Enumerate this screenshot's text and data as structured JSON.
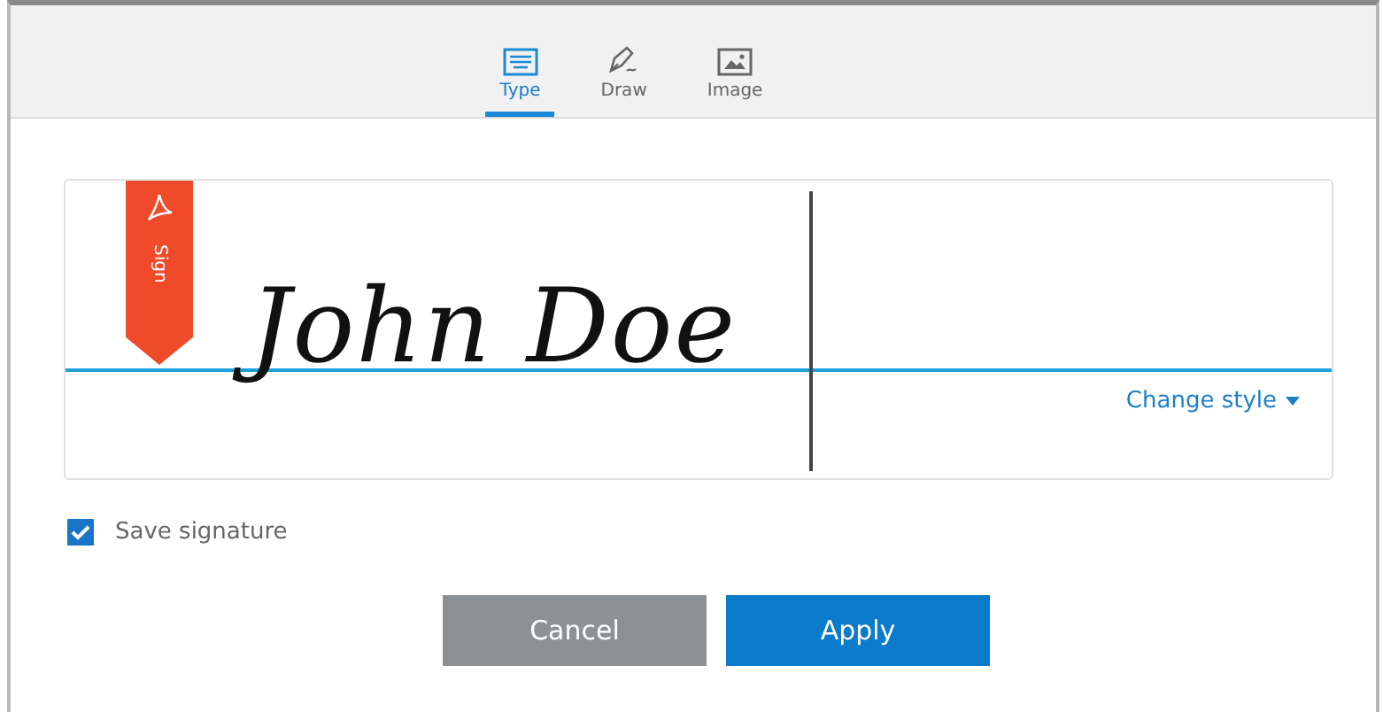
{
  "tabs": [
    {
      "label": "Type",
      "kind": "keyboard",
      "selected": true
    },
    {
      "label": "Draw",
      "kind": "pen",
      "selected": false
    },
    {
      "label": "Image",
      "kind": "image",
      "selected": false
    }
  ],
  "signature": {
    "badge": "Sign",
    "text": "John Doe",
    "change_style": "Change style"
  },
  "save_signature": {
    "label": "Save signature",
    "checked": true
  },
  "buttons": [
    {
      "label": "Cancel",
      "kind": "secondary"
    },
    {
      "label": "Apply",
      "kind": "primary"
    }
  ]
}
